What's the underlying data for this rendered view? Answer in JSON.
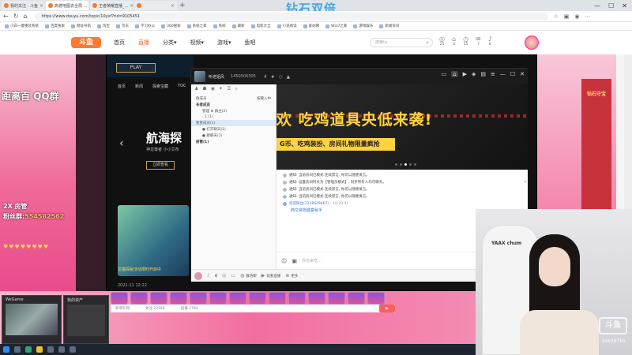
{
  "browser": {
    "tabs": [
      {
        "label": "我的关注 - 斗鱼",
        "active": false
      },
      {
        "label": "高德地图去全局 ...",
        "active": true
      },
      {
        "label": "王者荣耀直播_...",
        "active": false
      },
      {
        "label": "",
        "active": false
      }
    ],
    "url": "https://www.douyu.com/topic/10yxf?rid=9105451",
    "promo": "钻石双倍",
    "bookmarks": [
      "小白一键重装系统",
      "百度搜索",
      "网址导航",
      "淘宝",
      "京东",
      "学习办公",
      "360搜索",
      "系统之家",
      "系统",
      "最新",
      "电影大全",
      "小说阅读",
      "爱站网",
      "Win7之家",
      "游戏娱乐",
      "新闻资讯"
    ]
  },
  "douyu": {
    "logo": "斗鱼",
    "nav": [
      "首页",
      "直播",
      "分类▾",
      "视频▾",
      "游戏▾",
      "鱼吧"
    ],
    "active_nav": "直播",
    "search_placeholder": "搜索ta",
    "icons": [
      "25",
      "4",
      "15",
      "7",
      "8"
    ]
  },
  "background": {
    "left_title": "距离百 QQ群",
    "fan_line1": "2X 房管",
    "fan_line2": "粉丝群:",
    "fan_number": "554582562",
    "hearts": "♥♥♥♥♥♥♥♥",
    "right_label": "钻石守宝",
    "gift_info": [
      "新增礼物",
      "关注 22948",
      "直播 2784"
    ]
  },
  "video": {
    "play": "PLAY",
    "nav_items": [
      "首页",
      "新闻",
      "探索宝藏",
      "TOC"
    ],
    "title": "航海探",
    "subtitle": "神龙尊者  小小艾布",
    "button": "立即查看",
    "ticker": "龙猫探秘活动限时开启中",
    "timestamp": "2021-11 12:22"
  },
  "chat": {
    "name": "听老姐风",
    "id": "1450506305",
    "meta": [
      "4",
      "★",
      "◇",
      "▲"
    ],
    "left_panel": {
      "mode": "群成员",
      "hint": "按输入中",
      "rows": [
        {
          "text": "长者成员",
          "type": "grp"
        },
        {
          "text": "管理 ♛ 群主(2)",
          "type": "ind"
        },
        {
          "text": "· 1 (1)",
          "type": "ind"
        },
        {
          "text": "星星成员(1)",
          "type": "hl"
        },
        {
          "text": "● 打开聊天(1)",
          "type": "ind"
        },
        {
          "text": "● 群聊天(1)",
          "type": "ind"
        },
        {
          "text": "房管(1)",
          "type": "grp"
        }
      ]
    },
    "banner_big": "欢 吃鸡道具央低来袭!",
    "banner_strip": "G币、吃鸡装扮、房间礼物限量疯抢",
    "messages": [
      {
        "text": "通知: 当前房间已模式 连续禁言, 你可以随便发言。",
        "user": false
      },
      {
        "text": "通知: 设置房间时长为【管理员模式】, 同步所有人均可聊天。",
        "user": false
      },
      {
        "text": "通知: 当前房间已模式 连续禁言, 你可以随便发言。",
        "user": false
      },
      {
        "text": "通知: 当前房间已模式 连续禁言, 你可以随便发言。",
        "user": false
      }
    ],
    "user_message": {
      "name": "欢迎粉丝(2218629467)",
      "time": "19:29:21",
      "content": "西交良物盛宴秘手"
    },
    "input_placeholder": "你也来吃...",
    "bottom": [
      "群语聊",
      "观看直播",
      "更多",
      "群传递"
    ]
  },
  "webcam": {
    "chair_text": "YAAX chum",
    "logo": "斗鱼",
    "room_id": "10639765"
  },
  "taskbar": {
    "preview1_title": "WeGame",
    "preview2_title": "我的资产"
  }
}
